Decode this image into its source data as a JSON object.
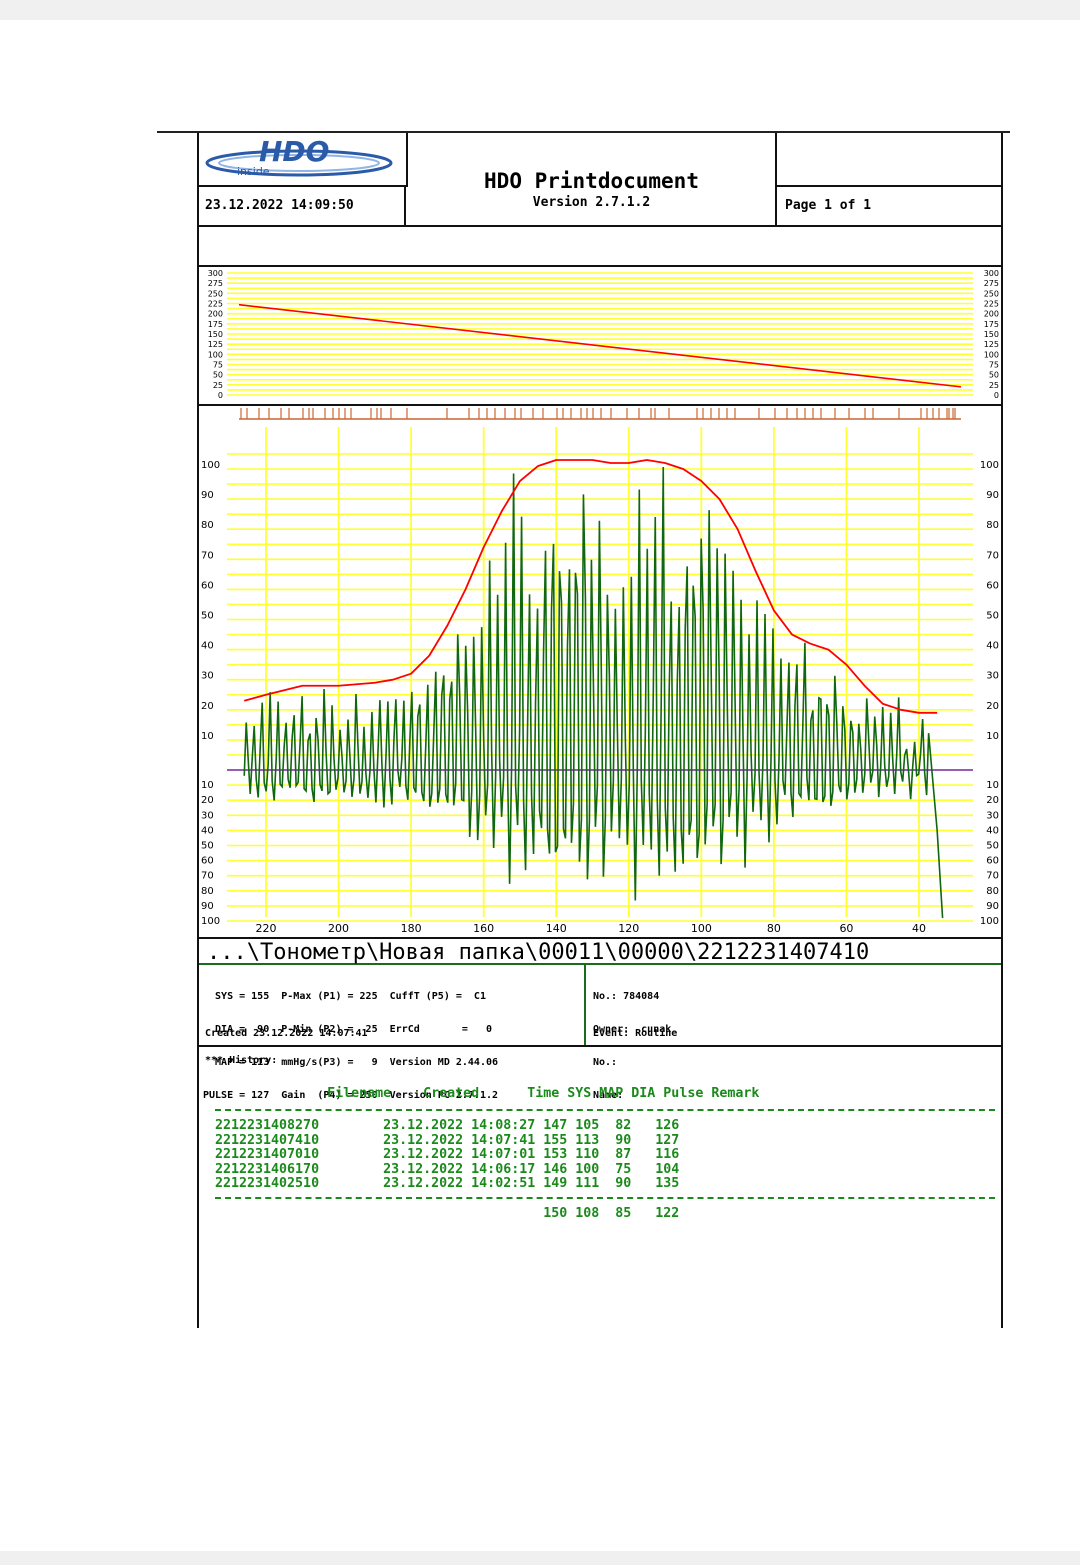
{
  "header": {
    "logo_text": "HDO",
    "logo_sub": "inside",
    "datetime": "23.12.2022 14:09:50",
    "title": "HDO Printdocument",
    "version": "Version 2.7.1.2",
    "page": "Page 1 of 1"
  },
  "colors": {
    "grid": "#ffff33",
    "signal": "#116611",
    "envelope": "#ff0000",
    "baseline": "#8844aa",
    "ticks": "#cc6633",
    "text_green": "#1a8a1a"
  },
  "chart_data": [
    {
      "type": "line",
      "title": "",
      "y_ticks": [
        "300",
        "275",
        "250",
        "225",
        "200",
        "175",
        "150",
        "125",
        "100",
        "75",
        "50",
        "25",
        "0"
      ],
      "ylim": [
        0,
        300
      ],
      "series": [
        {
          "x": [
            0,
            1
          ],
          "y": [
            222,
            20
          ]
        }
      ]
    },
    {
      "type": "line",
      "title": "",
      "y_ticks_upper": [
        "100",
        "90",
        "80",
        "70",
        "60",
        "50",
        "40",
        "30",
        "20",
        "10"
      ],
      "y_ticks_lower": [
        "10",
        "20",
        "30",
        "40",
        "50",
        "60",
        "70",
        "80",
        "90",
        "100"
      ],
      "x_ticks": [
        "220",
        "200",
        "180",
        "160",
        "140",
        "120",
        "100",
        "80",
        "60",
        "40"
      ],
      "xlim": [
        230,
        30
      ],
      "ylim": [
        -100,
        110
      ],
      "envelope": {
        "x": [
          226,
          220,
          210,
          200,
          190,
          185,
          180,
          175,
          170,
          165,
          160,
          155,
          150,
          145,
          140,
          135,
          130,
          125,
          120,
          115,
          110,
          105,
          100,
          95,
          90,
          85,
          80,
          75,
          70,
          65,
          60,
          55,
          50,
          45,
          40,
          35
        ],
        "y": [
          23,
          25,
          28,
          28,
          29,
          30,
          32,
          38,
          48,
          60,
          74,
          86,
          96,
          101,
          103,
          103,
          103,
          102,
          102,
          103,
          102,
          100,
          96,
          90,
          80,
          66,
          53,
          45,
          42,
          40,
          35,
          28,
          22,
          20,
          19,
          19
        ]
      },
      "baseline": 0
    }
  ],
  "file_path": "...\\Тонометр\\Новая папка\\00011\\00000\\2212231407410",
  "info": {
    "left_lines": [
      "  SYS = 155  P-Max (P1) = 225  CuffT (P5) =  C1",
      "  DIA =  90  P-Min (P2) =  25  ErrCd       =   0",
      "  MAP = 113  mmHg/s(P3) =   9  Version MD 2.44.06",
      "PULSE = 127  Gain  (P4) = 250  Version PC 2.7.1.2"
    ],
    "right_lines": [
      "No.: 784084",
      "Owner:  cunak",
      "No.:",
      "Name:"
    ],
    "created": "Created  23.12.2022 14:07:41",
    "event": "Event: Routine"
  },
  "history": {
    "title": "*** History:",
    "columns_line": "              Filename    Created      Time SYS MAP DIA Pulse Remark",
    "rows": [
      "2212231408270        23.12.2022 14:08:27 147 105  82   126",
      "2212231407410        23.12.2022 14:07:41 155 113  90   127",
      "2212231407010        23.12.2022 14:07:01 153 110  87   116",
      "2212231406170        23.12.2022 14:06:17 146 100  75   104",
      "2212231402510        23.12.2022 14:02:51 149 111  90   135"
    ],
    "average": "                                         150 108  85   122"
  }
}
